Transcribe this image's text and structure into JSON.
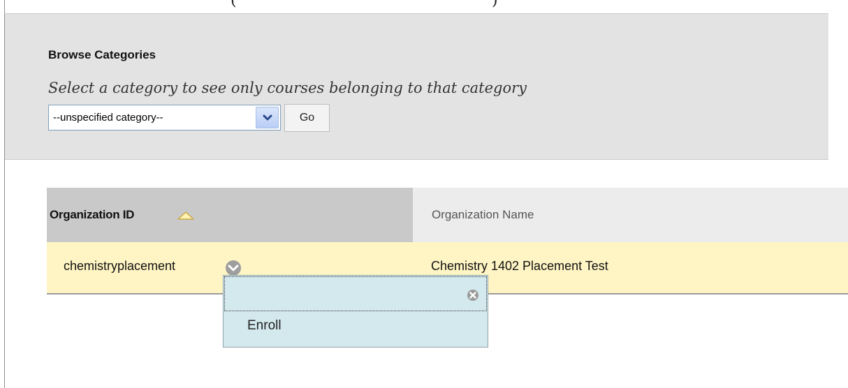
{
  "header": {
    "partial_paren_open": "(",
    "partial_paren_close": ")"
  },
  "browse": {
    "title": "Browse Categories",
    "description": "Select a category to see only courses belonging to that category",
    "select_value": "--unspecified category--",
    "go_label": "Go"
  },
  "table": {
    "columns": [
      {
        "label": "Organization ID",
        "sorted": "ascending"
      },
      {
        "label": "Organization Name"
      }
    ],
    "rows": [
      {
        "id": "chemistryplacement",
        "name": "Chemistry 1402 Placement Test"
      }
    ]
  },
  "context_menu": {
    "items": [
      "Enroll"
    ]
  },
  "colors": {
    "panel_bg": "#e3e3e3",
    "row_highlight": "#fff5c4",
    "menu_bg": "#d3e9ee",
    "sorted_header_bg": "#c9c9c9"
  },
  "icons": {
    "sort": "sort-ascending-icon",
    "row_menu": "chevron-down-icon",
    "menu_close": "close-icon",
    "select_arrow": "dropdown-arrow-icon"
  }
}
